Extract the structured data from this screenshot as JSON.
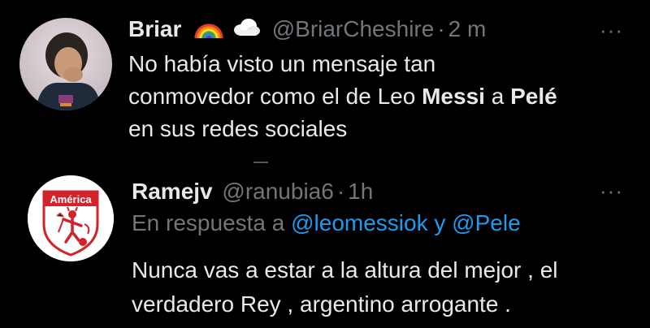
{
  "tweet1": {
    "name": "Briar",
    "emoji_rainbow": "rainbow-icon",
    "emoji_cloud": "cloud-icon",
    "handle": "@BriarCheshire",
    "separator": "·",
    "time": "2 m",
    "text_parts": [
      {
        "text": "No había visto un mensaje tan\nconmovedor como el de Leo ",
        "bold": false
      },
      {
        "text": "Messi",
        "bold": true
      },
      {
        "text": " a ",
        "bold": false
      },
      {
        "text": "Pelé",
        "bold": true
      },
      {
        "text": "\nen sus redes sociales",
        "bold": false
      }
    ],
    "more": "···"
  },
  "tweet2": {
    "name": "Ramejv",
    "handle": "@ranubia6",
    "separator": "·",
    "time": "1h",
    "reply_prefix": "En respuesta a",
    "reply_mention1": "@leomessiok",
    "reply_join": "y",
    "reply_mention2": "@Pele",
    "text": "Nunca vas a estar a la altura del mejor , el\nverdadero Rey , argentino arrogante .",
    "more": "···",
    "avatar_label": "América"
  },
  "colors": {
    "background": "#000000",
    "text": "#e7e9ea",
    "secondary": "#71767b",
    "link": "#1d9bf0",
    "america_red": "#d2232a"
  }
}
